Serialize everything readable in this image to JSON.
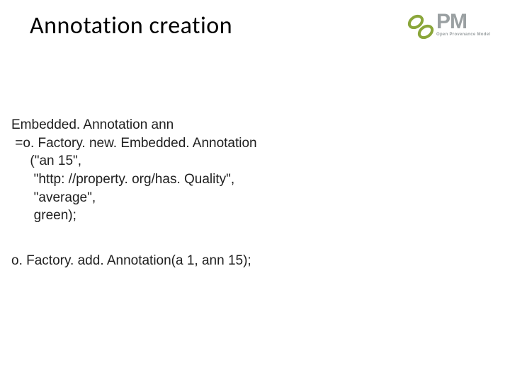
{
  "title": "Annotation creation",
  "logo": {
    "big": "PM",
    "small": "Open Provenance Model"
  },
  "code": {
    "block1": {
      "l1": "Embedded. Annotation ann",
      "l2": " =o. Factory. new. Embedded. Annotation",
      "l3": "     (\"an 15\",",
      "l4": "      \"http: //property. org/has. Quality\",",
      "l5": "      \"average\",",
      "l6": "      green);"
    },
    "block2": "o. Factory. add. Annotation(a 1, ann 15);"
  }
}
